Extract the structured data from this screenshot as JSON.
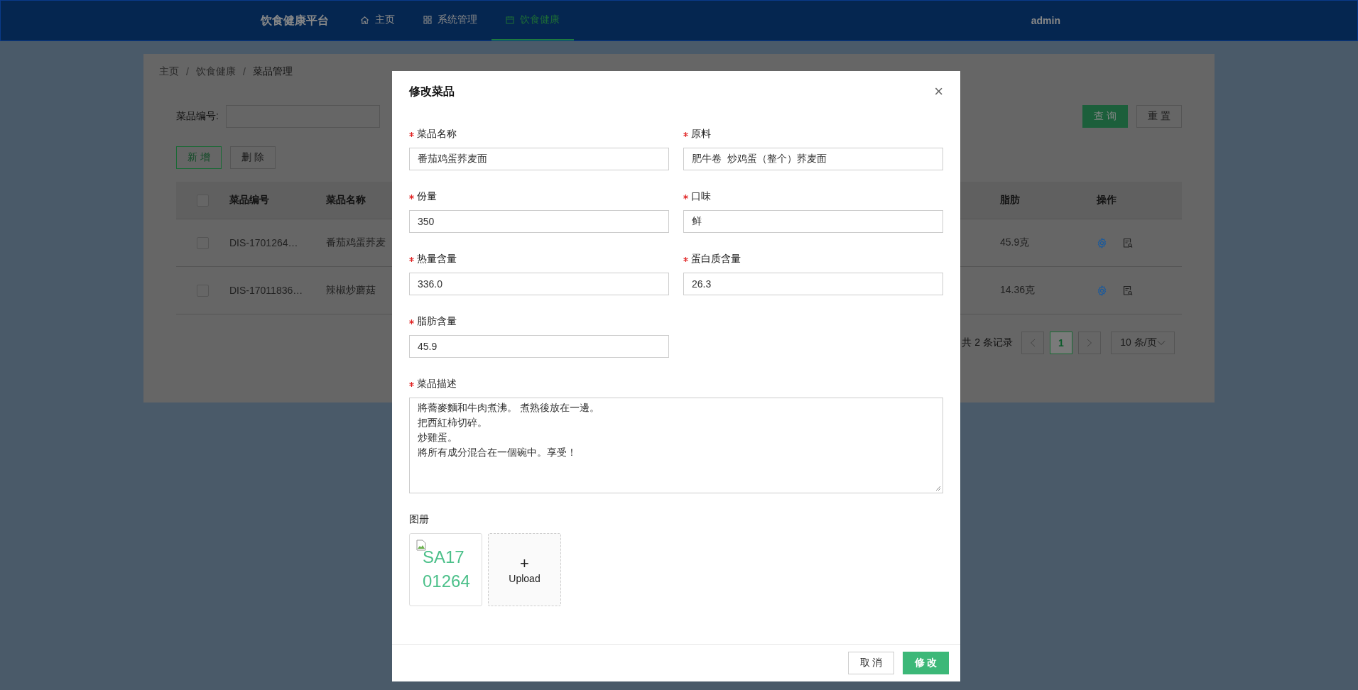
{
  "nav": {
    "brand": "饮食健康平台",
    "items": [
      {
        "label": "主页",
        "selected": false
      },
      {
        "label": "系统管理",
        "selected": false
      },
      {
        "label": "饮食健康",
        "selected": true
      }
    ],
    "user": "admin"
  },
  "breadcrumb": [
    {
      "label": "主页"
    },
    {
      "separator": "/",
      "label": "饮食健康"
    },
    {
      "separator": "/",
      "label": "菜品管理"
    }
  ],
  "search": {
    "label": "菜品编号:",
    "buttons": [
      {
        "label": "查 询",
        "kind": "primary"
      },
      {
        "label": "重 置",
        "kind": "default"
      }
    ]
  },
  "actions": [
    {
      "label": "新 增",
      "kind": "outline"
    },
    {
      "label": "删 除",
      "kind": "default"
    }
  ],
  "table": {
    "header_checked": false,
    "columns_left": [
      "菜品编号",
      "菜品名称"
    ],
    "columns_right": [
      "脂肪",
      "操作"
    ],
    "rows": [
      {
        "checked": false,
        "code": "DIS-1701264…",
        "name": "番茄鸡蛋荞麦",
        "fat": "45.9克"
      },
      {
        "checked": false,
        "code": "DIS-17011836…",
        "name": "辣椒炒蘑菇",
        "fat": "14.36克"
      }
    ]
  },
  "pagination": {
    "total": "共 2 条记录",
    "pages": [
      {
        "label": "1",
        "selected": true
      }
    ],
    "page_size": "10 条/页"
  },
  "dialog": {
    "title": "修改菜品",
    "close": "×",
    "fields": [
      {
        "label": "菜品名称",
        "value": "番茄鸡蛋荞麦面",
        "required": true
      },
      {
        "label": "原料",
        "value": "肥牛卷  炒鸡蛋（整个）荞麦面",
        "required": true
      },
      {
        "label": "份量",
        "value": "350",
        "required": true
      },
      {
        "label": "口味",
        "value": "鲜",
        "required": true
      },
      {
        "label": "热量含量",
        "value": "336.0",
        "required": true
      },
      {
        "label": "蛋白质含量",
        "value": "26.3",
        "required": true
      },
      {
        "label": "脂肪含量",
        "value": "45.9",
        "required": true
      }
    ],
    "description": {
      "label": "菜品描述",
      "required": true,
      "lines": [
        "將蕎麥麵和牛肉煮沸。 煮熟後放在一邊。",
        "把西紅柿切碎。",
        "炒雞蛋。",
        "將所有成分混合在一個碗中。享受！"
      ]
    },
    "gallery": {
      "label": "图册",
      "images": [
        {
          "alt": "SA1701264"
        }
      ],
      "upload": {
        "icon": "+",
        "label": "Upload"
      }
    },
    "buttons": [
      {
        "label": "取 消",
        "kind": "default"
      },
      {
        "label": "修 改",
        "kind": "primary"
      }
    ]
  }
}
